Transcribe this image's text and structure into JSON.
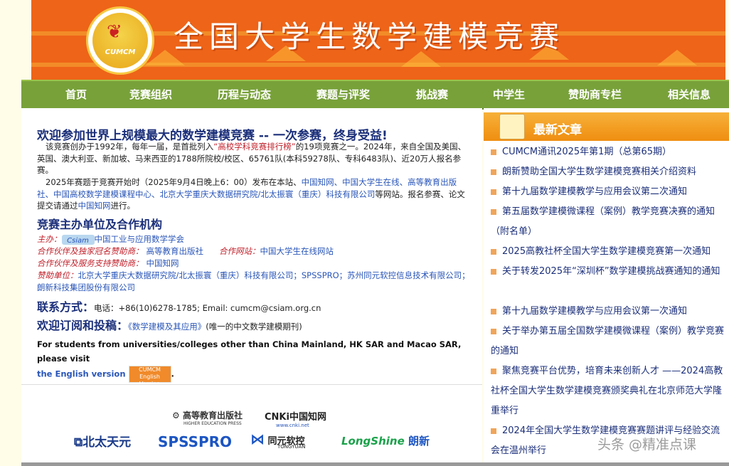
{
  "header": {
    "title": "全国大学生数学建模竞赛",
    "logo_text": "CUMCM"
  },
  "nav": [
    "首页",
    "竞赛组织",
    "历程与动态",
    "赛题与评奖",
    "挑战赛",
    "中学生",
    "赞助商专栏",
    "相关信息"
  ],
  "main": {
    "welcome_title": "欢迎参加世界上规模最大的数学建模竞赛 -- 一次参赛，终身受益!",
    "para1_a": "该竞赛创办于1992年，每年一届，是首批列入",
    "para1_link": "“高校学科竞赛排行榜”",
    "para1_b": "的19项竞赛之一。2024年，来自全国及美国、英国、澳大利亚、新加坡、马来西亚的1788所院校/校区、65761队(本科59278队、专科6483队)、近20万人报名参赛。",
    "para2_a": "2025年赛题于竞赛开始时（2025年9月4日晚上6：00）发布在本站、",
    "para2_links": "中国知网、中国大学生在线、高等教育出版社、中国高校数学建模课程中心、北京大学重庆大数据研究院/北太振寰（重庆）科技有限公司",
    "para2_b": "等网站。报名参赛、论文提交请通过",
    "para2_link2": "中国知网",
    "para2_c": "进行。",
    "orgs_title": "竞赛主办单位及合作机构",
    "host_label": "主办：",
    "host_badge": "Csiam",
    "host_name": "中国工业与应用数学学会",
    "partner_label": "合作伙伴及独家冠名赞助商：",
    "partner_name": "高等教育出版社",
    "website_label": "合作网站：",
    "website_name": "中国大学生在线网站",
    "service_label": "合作伙伴及服务支持赞助商：",
    "service_name": "中国知网",
    "sponsor_label": "赞助单位：",
    "sponsor_names": "北京大学重庆大数据研究院/北太振寰（重庆）科技有限公司；SPSSPRO；苏州同元软控信息技术有限公司；朗新科技集团股份有限公司",
    "contact_title": "联系方式：",
    "contact_text": "电话：+86(10)6278-1785; Email: cumcm@csiam.org.cn",
    "subscribe_title": "欢迎订阅和投稿：",
    "journal_link": "《数学建模及其应用》",
    "journal_desc": "(唯一的中文数学建模期刊)",
    "english_text": "For students from universities/colleges other than China Mainland, HK SAR and Macao SAR, please visit",
    "english_link": "the English version",
    "english_btn": "CUMCM English Version"
  },
  "sponsors": {
    "hep": "高等教育出版社",
    "hep_en": "HIGHER EDUCATION PRESS",
    "cnki": "CNKi中国知网",
    "cnki_url": "www.cnki.net",
    "beitai": "北太天元",
    "spsspro": "SPSSPRO",
    "tongyuan": "同元软控",
    "tongyuan_en": "TONGYUAN",
    "longshine": "LongShine",
    "longshine_cn": "朗新"
  },
  "sidebar": {
    "title": "最新文章",
    "articles": [
      "CUMCM通讯2025年第1期（总第65期）",
      "朗新赞助全国大学生数学建模竞赛相关介绍资料",
      "第十九届数学建模教学与应用会议第二次通知",
      "第五届数学建模微课程（案例）教学竞赛决赛的通知（附名单）",
      "2025高教社杯全国大学生数学建模竞赛第一次通知",
      "关于转发2025年“深圳杯”数学建模挑战赛通知的通知",
      "第十九届数学建模教学与应用会议第一次通知",
      "关于举办第五届全国数学建模微课程（案例）教学竞赛的通知",
      "聚焦竞赛平台优势，培育未来创新人才 ——2024高教社杯全国大学生数学建模竞赛颁奖典礼在北京师范大学隆重举行",
      "2024年全国大学生数学建模竞赛赛题讲评与经验交流会在温州举行"
    ]
  },
  "watermark": "头条 @精准点课",
  "colors": {
    "header_orange": "#ee6418",
    "nav_green": "#78a13a",
    "title_blue": "#1b2f7a",
    "link_blue": "#2a56b8",
    "sidebar_orange": "#ef8e10"
  }
}
